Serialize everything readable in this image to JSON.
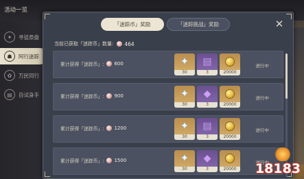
{
  "header": {
    "title": "活动一览"
  },
  "sidebar": {
    "items": [
      {
        "label": "寻徒原盘",
        "icon": "compass-icon"
      },
      {
        "label": "阿行迷踪",
        "icon": "cat-mask-icon"
      },
      {
        "label": "万民同行",
        "icon": "fan-icon"
      },
      {
        "label": "自试身手",
        "icon": "book-icon"
      }
    ]
  },
  "panel": {
    "tabs": [
      {
        "label": "「迷踪币」奖励",
        "active": true
      },
      {
        "label": "「迷踪挑战」奖励",
        "active": false
      }
    ],
    "close_icon": "close-icon",
    "count_label": "当前已获取「迷踪币」数量:",
    "count_value": "464",
    "rows": [
      {
        "label": "累计获得「迷踪币」:",
        "value": "600",
        "status": "进行中",
        "rewards": [
          {
            "icon": "primogem-star-icon",
            "qty": "30"
          },
          {
            "icon": "book-icon",
            "qty": "3"
          },
          {
            "icon": "mora-coin-icon",
            "qty": "20000"
          }
        ]
      },
      {
        "label": "累计获得「迷踪币」:",
        "value": "900",
        "status": "进行中",
        "rewards": [
          {
            "icon": "primogem-star-icon",
            "qty": "30"
          },
          {
            "icon": "ore-icon",
            "qty": "3"
          },
          {
            "icon": "mora-coin-icon",
            "qty": "20000"
          }
        ]
      },
      {
        "label": "累计获得「迷踪币」:",
        "value": "1200",
        "status": "进行中",
        "rewards": [
          {
            "icon": "primogem-star-icon",
            "qty": "30"
          },
          {
            "icon": "book-icon",
            "qty": "3"
          },
          {
            "icon": "mora-coin-icon",
            "qty": "20000"
          }
        ]
      },
      {
        "label": "累计获得「迷踪币」:",
        "value": "1500",
        "status": "进行中",
        "rewards": [
          {
            "icon": "primogem-star-icon",
            "qty": "30"
          },
          {
            "icon": "ore-icon",
            "qty": "3"
          },
          {
            "icon": "mora-coin-icon",
            "qty": "20000"
          }
        ]
      }
    ]
  },
  "watermark": {
    "text": "18183"
  },
  "colors": {
    "panel_bg": "#3a3f4c",
    "row_bg": "#4b5160",
    "tab_active_bg": "#ece5d3",
    "accent_gold": "#c9b58c"
  }
}
